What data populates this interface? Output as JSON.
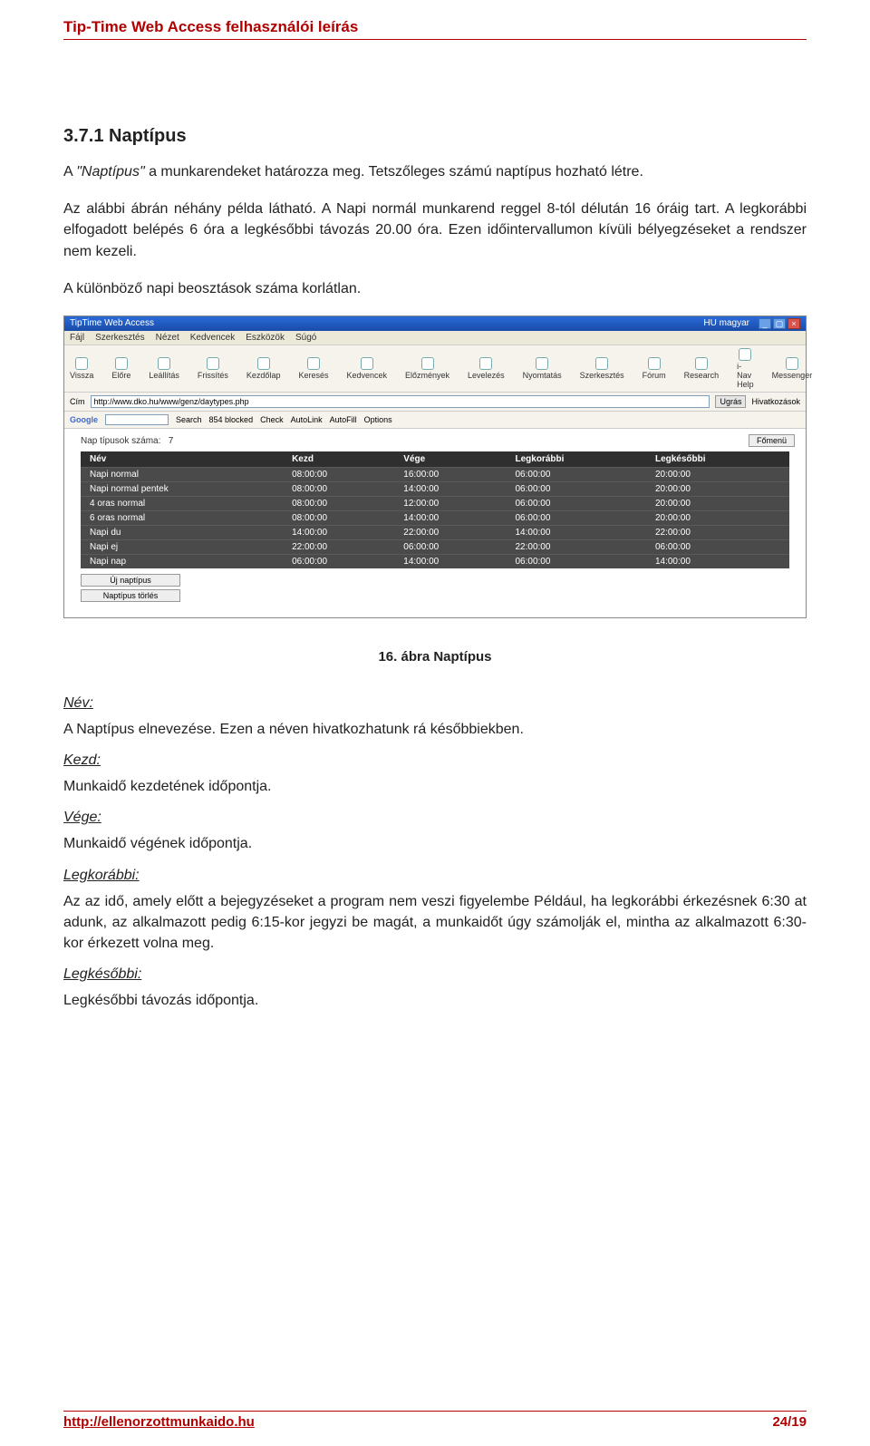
{
  "header": {
    "title": "Tip-Time Web Access felhasználói leírás"
  },
  "section": {
    "num_title": "3.7.1  Naptípus",
    "para1_a": "A ",
    "para1_em": "\"Naptípus\"",
    "para1_b": " a munkarendeket határozza meg. Tetszőleges számú naptípus hozható létre.",
    "para2": "Az alábbi ábrán néhány példa látható. A Napi normál munkarend reggel 8-tól délután 16 óráig tart. A legkorábbi elfogadott belépés 6 óra a legkésőbbi távozás 20.00 óra. Ezen időintervallumon kívüli bélyegzéseket a rendszer nem kezeli.",
    "para3": "A különböző napi beosztások száma korlátlan."
  },
  "shot": {
    "windowTitle": "TipTime Web Access",
    "lang": "HU magyar",
    "menu": [
      "Fájl",
      "Szerkesztés",
      "Nézet",
      "Kedvencek",
      "Eszközök",
      "Súgó"
    ],
    "toolbar": [
      "Vissza",
      "Előre",
      "Leállítás",
      "Frissítés",
      "Kezdőlap",
      "Keresés",
      "Kedvencek",
      "Előzmények",
      "Levelezés",
      "Nyomtatás",
      "Szerkesztés",
      "Fórum",
      "Research",
      "i-Nav Help",
      "Messenger"
    ],
    "addrLabel": "Cím",
    "addr": "http://www.dko.hu/www/genz/daytypes.php",
    "go": "Ugrás",
    "links": "Hivatkozások",
    "google": {
      "name": "Google",
      "search": "Search",
      "blocked": "854 blocked",
      "check": "Check",
      "autolink": "AutoLink",
      "autofill": "AutoFill",
      "options": "Options"
    },
    "content": {
      "countLabel": "Nap típusok száma:",
      "count": "7",
      "fomenu": "Főmenü",
      "headers": [
        "Név",
        "Kezd",
        "Vége",
        "Legkorábbi",
        "Legkésőbbi"
      ],
      "rows": [
        [
          "Napi normal",
          "08:00:00",
          "16:00:00",
          "06:00:00",
          "20:00:00"
        ],
        [
          "Napi normal pentek",
          "08:00:00",
          "14:00:00",
          "06:00:00",
          "20:00:00"
        ],
        [
          "4 oras normal",
          "08:00:00",
          "12:00:00",
          "06:00:00",
          "20:00:00"
        ],
        [
          "6 oras normal",
          "08:00:00",
          "14:00:00",
          "06:00:00",
          "20:00:00"
        ],
        [
          "Napi du",
          "14:00:00",
          "22:00:00",
          "14:00:00",
          "22:00:00"
        ],
        [
          "Napi ej",
          "22:00:00",
          "06:00:00",
          "22:00:00",
          "06:00:00"
        ],
        [
          "Napi nap",
          "06:00:00",
          "14:00:00",
          "06:00:00",
          "14:00:00"
        ]
      ],
      "btn_new": "Új naptípus",
      "btn_del": "Naptípus törlés"
    }
  },
  "figcaption": "16. ábra Naptípus",
  "defs": {
    "nev": {
      "t": "Név:",
      "b": "A Naptípus elnevezése. Ezen a néven hivatkozhatunk rá későbbiekben."
    },
    "kezd": {
      "t": "Kezd:",
      "b": "Munkaidő kezdetének időpontja."
    },
    "vege": {
      "t": "Vége:",
      "b": "Munkaidő végének időpontja."
    },
    "legkorabbi": {
      "t": "Legkorábbi:",
      "b": "Az az idő, amely előtt a bejegyzéseket a program nem veszi figyelembe Például, ha legkorábbi érkezésnek 6:30 at adunk, az alkalmazott pedig 6:15-kor jegyzi be magát, a munkaidőt úgy számolják el, mintha az alkalmazott 6:30-kor érkezett volna meg."
    },
    "legkesobbi": {
      "t": "Legkésőbbi:",
      "b": "Legkésőbbi távozás időpontja."
    }
  },
  "footer": {
    "url": "http://ellenorzottmunkaido.hu",
    "page": "24/19"
  }
}
